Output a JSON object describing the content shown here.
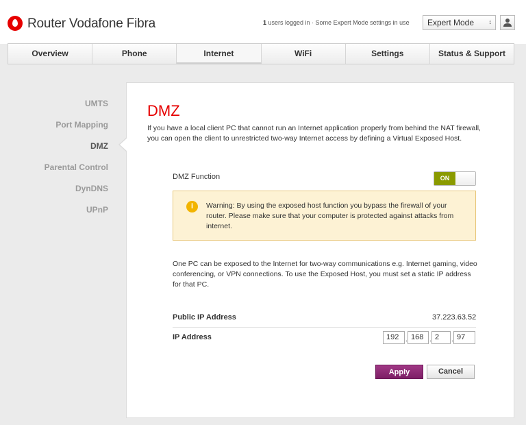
{
  "header": {
    "brand": "Router Vodafone Fibra",
    "users_count": "1",
    "users_text": " users logged in · Some Expert Mode settings in use",
    "mode_selected": "Expert Mode"
  },
  "nav": {
    "tabs": [
      {
        "label": "Overview",
        "active": false
      },
      {
        "label": "Phone",
        "active": false
      },
      {
        "label": "Internet",
        "active": true
      },
      {
        "label": "WiFi",
        "active": false
      },
      {
        "label": "Settings",
        "active": false
      },
      {
        "label": "Status & Support",
        "active": false
      }
    ]
  },
  "sidebar": {
    "items": [
      {
        "label": "UMTS",
        "active": false
      },
      {
        "label": "Port Mapping",
        "active": false
      },
      {
        "label": "DMZ",
        "active": true
      },
      {
        "label": "Parental Control",
        "active": false
      },
      {
        "label": "DynDNS",
        "active": false
      },
      {
        "label": "UPnP",
        "active": false
      }
    ]
  },
  "main": {
    "title": "DMZ",
    "intro": "If you have a local client PC that cannot run an Internet application properly from behind the NAT firewall, you can open the client to unrestricted two-way Internet access by defining a Virtual Exposed Host.",
    "dmz_function_label": "DMZ Function",
    "toggle_label": "ON",
    "warning_icon": "i",
    "warning_text": "Warning: By using the exposed host function you bypass the firewall of your router. Please make sure that your computer is protected against attacks from internet.",
    "exposed_text": "One PC can be exposed to the Internet for two-way communications e.g. Internet gaming, video conferencing, or VPN connections. To use the Exposed Host, you must set a static IP address for that PC.",
    "public_ip_label": "Public IP Address",
    "public_ip_value": "37.223.63.52",
    "ip_label": "IP Address",
    "ip_octets": [
      "192",
      "168",
      "2",
      "97"
    ],
    "ip_separator": ".",
    "apply_label": "Apply",
    "cancel_label": "Cancel"
  },
  "colors": {
    "accent_red": "#e60000",
    "toggle_green": "#8a9a00",
    "apply_purple": "#7d1f66",
    "warning_bg": "#fdf2d4"
  },
  "icons": [
    "vodafone-logo-icon",
    "dropdown-arrow-icon",
    "user-icon",
    "info-icon"
  ]
}
